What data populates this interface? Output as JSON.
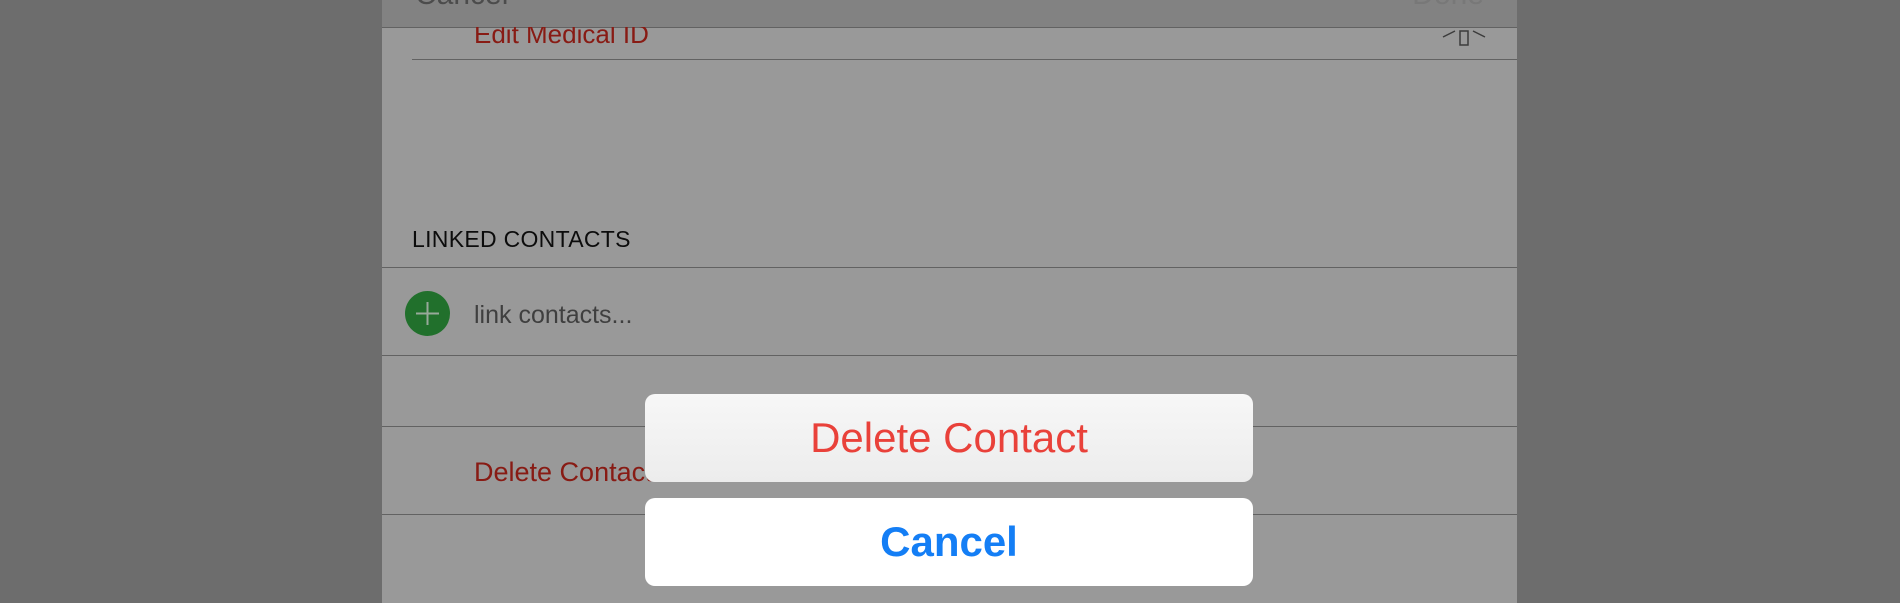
{
  "nav": {
    "cancel_label": "Cancel",
    "done_label": "Done"
  },
  "medical": {
    "label": "Edit Medical ID",
    "icon": "medical-id-icon"
  },
  "linked_contacts": {
    "header": "LINKED CONTACTS",
    "add_icon": "plus-icon",
    "link_label": "link contacts..."
  },
  "delete_row": {
    "label": "Delete Contact"
  },
  "action_sheet": {
    "delete_label": "Delete Contact",
    "cancel_label": "Cancel"
  },
  "colors": {
    "destructive": "#e9413a",
    "accent": "#147ef5",
    "add": "#2f9e3f"
  }
}
